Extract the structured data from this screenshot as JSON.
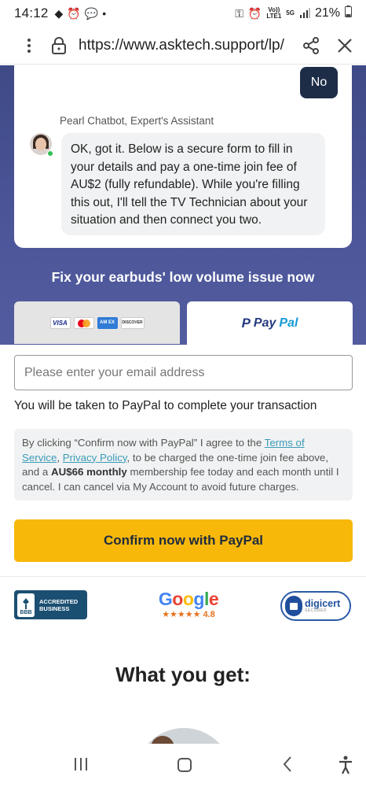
{
  "status_bar": {
    "time": "14:12",
    "network_top": "Vo))",
    "network_bottom": "LTE1",
    "network_type": "5G",
    "battery": "21%"
  },
  "browser": {
    "url": "https://www.asktech.support/lp/"
  },
  "chat": {
    "user_reply": "No",
    "bot_name": "Pearl Chatbot, Expert's Assistant",
    "bot_message": "OK, got it. Below is a secure form to fill in your details and pay a one-time join fee of AU$2 (fully refundable). While you're filling this out, I'll tell the TV Technician about your situation and then connect you two."
  },
  "headline": "Fix your earbuds' low volume issue now",
  "payment_tabs": {
    "card_logos": [
      "VISA",
      "",
      "AM EX",
      "DISCOVER"
    ],
    "paypal_p": "P",
    "paypal_pay": "Pay",
    "paypal_pal": "Pal"
  },
  "form": {
    "email_placeholder": "Please enter your email address",
    "paypal_note": "You will be taken to PayPal to complete your transaction",
    "terms_pre": "By clicking “Confirm now with PayPal” I agree to the ",
    "terms_link": "Terms of Service",
    "terms_comma": ", ",
    "privacy_link": "Privacy Policy",
    "terms_mid": ", to be charged the one-time join fee above, and a ",
    "terms_bold": "AU$66 monthly",
    "terms_post": " membership fee today and each month until I cancel. I can cancel via My Account to avoid future charges.",
    "confirm_label": "Confirm now with PayPal"
  },
  "trust": {
    "bbb_line1": "ACCREDITED",
    "bbb_line2": "BUSINESS",
    "bbb_mark": "BBB",
    "google_word": "Google",
    "google_stars": "★★★★★",
    "google_rating": "4.8",
    "digicert_name": "digicert",
    "digicert_sub": "SECURED"
  },
  "what_you_get": "What you get:",
  "colors": {
    "purple_top": "#3f4a86",
    "confirm_bg": "#f8b80a",
    "no_btn": "#1e2d47",
    "link": "#3a9bb8"
  }
}
